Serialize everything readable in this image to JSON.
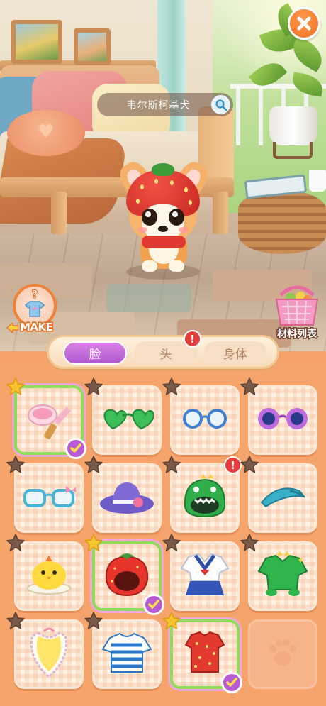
{
  "header": {
    "pet_name": "韦尔斯柯基犬",
    "close_icon": "close-icon",
    "search_icon": "search-icon"
  },
  "side_buttons": {
    "make_label": "MAKE",
    "materials_label": "材料列表"
  },
  "tabs": [
    {
      "label": "脸",
      "active": true,
      "alert": false
    },
    {
      "label": "头",
      "active": false,
      "alert": true
    },
    {
      "label": "身体",
      "active": false,
      "alert": false
    }
  ],
  "alert_glyph": "!",
  "items": [
    {
      "name": "makeup-brush",
      "icon": "makeup-brush-icon",
      "star": "gold",
      "selected": true,
      "equipped": true,
      "alert": false
    },
    {
      "name": "heart-sunglasses",
      "icon": "green-heart-glasses-icon",
      "star": "dark",
      "selected": false,
      "equipped": false,
      "alert": false
    },
    {
      "name": "round-glasses",
      "icon": "blue-round-glasses-icon",
      "star": "dark",
      "selected": false,
      "equipped": false,
      "alert": false
    },
    {
      "name": "flower-glasses",
      "icon": "purple-flower-glasses-icon",
      "star": "dark",
      "selected": false,
      "equipped": false,
      "alert": false
    },
    {
      "name": "bow-glasses",
      "icon": "cyan-bow-glasses-icon",
      "star": "dark",
      "selected": false,
      "equipped": false,
      "alert": false
    },
    {
      "name": "sun-hat",
      "icon": "purple-sun-hat-icon",
      "star": "dark",
      "selected": false,
      "equipped": false,
      "alert": false
    },
    {
      "name": "dino-hood",
      "icon": "green-dino-hood-icon",
      "star": "dark",
      "selected": false,
      "equipped": false,
      "alert": true
    },
    {
      "name": "visor-cap",
      "icon": "teal-visor-icon",
      "star": "dark",
      "selected": false,
      "equipped": false,
      "alert": false
    },
    {
      "name": "chick-hat",
      "icon": "yellow-chick-hat-icon",
      "star": "dark",
      "selected": false,
      "equipped": false,
      "alert": false
    },
    {
      "name": "strawberry-hood",
      "icon": "strawberry-hood-icon",
      "star": "gold",
      "selected": true,
      "equipped": true,
      "alert": false
    },
    {
      "name": "sailor-uniform",
      "icon": "sailor-uniform-icon",
      "star": "dark",
      "selected": false,
      "equipped": false,
      "alert": false
    },
    {
      "name": "dino-costume",
      "icon": "green-dino-costume-icon",
      "star": "dark",
      "selected": false,
      "equipped": false,
      "alert": false
    },
    {
      "name": "bib",
      "icon": "yellow-bib-icon",
      "star": "dark",
      "selected": false,
      "equipped": false,
      "alert": false
    },
    {
      "name": "striped-shirt",
      "icon": "blue-striped-shirt-icon",
      "star": "dark",
      "selected": false,
      "equipped": false,
      "alert": false
    },
    {
      "name": "strawberry-vest",
      "icon": "red-polka-vest-icon",
      "star": "gold",
      "selected": true,
      "equipped": true,
      "alert": false
    },
    {
      "name": "empty-slot",
      "icon": "paw-icon",
      "star": "none",
      "selected": false,
      "equipped": false,
      "alert": false
    }
  ],
  "colors": {
    "accent_orange": "#f07025",
    "tab_active": "#b058cf",
    "panel": "#f5a46b",
    "select_green": "#8fdc5a",
    "star_gold": "#f7c531",
    "star_dark": "#7a5a4a",
    "alert_red": "#e63c3c"
  }
}
